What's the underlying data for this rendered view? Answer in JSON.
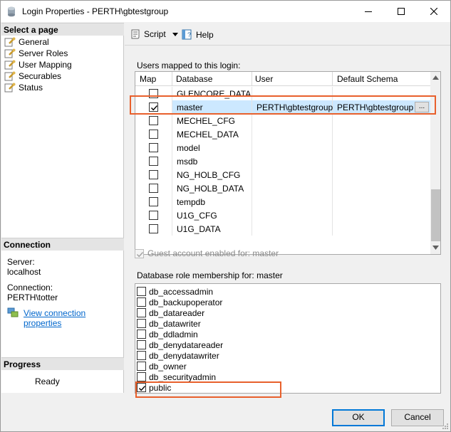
{
  "window": {
    "title": "Login Properties - PERTH\\gbtestgroup"
  },
  "left": {
    "select_page_header": "Select a page",
    "pages": [
      "General",
      "Server Roles",
      "User Mapping",
      "Securables",
      "Status"
    ],
    "connection_header": "Connection",
    "server_label": "Server:",
    "server_value": "localhost",
    "connection_label": "Connection:",
    "connection_value": "PERTH\\totter",
    "view_connection_link": "View connection properties",
    "progress_header": "Progress",
    "progress_status": "Ready"
  },
  "toolbar": {
    "script_label": "Script",
    "help_label": "Help"
  },
  "mapping": {
    "section_label": "Users mapped to this login:",
    "columns": [
      "Map",
      "Database",
      "User",
      "Default Schema"
    ],
    "rows": [
      {
        "checked": false,
        "database": "GLENCORE_DATA",
        "user": "",
        "schema": ""
      },
      {
        "checked": true,
        "database": "master",
        "user": "PERTH\\gbtestgroup",
        "schema": "PERTH\\gbtestgroup",
        "ellipsis": "..."
      },
      {
        "checked": false,
        "database": "MECHEL_CFG",
        "user": "",
        "schema": ""
      },
      {
        "checked": false,
        "database": "MECHEL_DATA",
        "user": "",
        "schema": ""
      },
      {
        "checked": false,
        "database": "model",
        "user": "",
        "schema": ""
      },
      {
        "checked": false,
        "database": "msdb",
        "user": "",
        "schema": ""
      },
      {
        "checked": false,
        "database": "NG_HOLB_CFG",
        "user": "",
        "schema": ""
      },
      {
        "checked": false,
        "database": "NG_HOLB_DATA",
        "user": "",
        "schema": ""
      },
      {
        "checked": false,
        "database": "tempdb",
        "user": "",
        "schema": ""
      },
      {
        "checked": false,
        "database": "U1G_CFG",
        "user": "",
        "schema": ""
      },
      {
        "checked": false,
        "database": "U1G_DATA",
        "user": "",
        "schema": ""
      }
    ]
  },
  "guest": {
    "label": "Guest account enabled for: master",
    "checked": true,
    "disabled": true
  },
  "roles": {
    "section_label": "Database role membership for: master",
    "items": [
      {
        "name": "db_accessadmin",
        "checked": false
      },
      {
        "name": "db_backupoperator",
        "checked": false
      },
      {
        "name": "db_datareader",
        "checked": false
      },
      {
        "name": "db_datawriter",
        "checked": false
      },
      {
        "name": "db_ddladmin",
        "checked": false
      },
      {
        "name": "db_denydatareader",
        "checked": false
      },
      {
        "name": "db_denydatawriter",
        "checked": false
      },
      {
        "name": "db_owner",
        "checked": false
      },
      {
        "name": "db_securityadmin",
        "checked": false
      },
      {
        "name": "public",
        "checked": true
      }
    ]
  },
  "buttons": {
    "ok": "OK",
    "cancel": "Cancel"
  },
  "colors": {
    "highlight": "#e8602c",
    "selection": "#cce8ff",
    "link": "#0066cc"
  }
}
